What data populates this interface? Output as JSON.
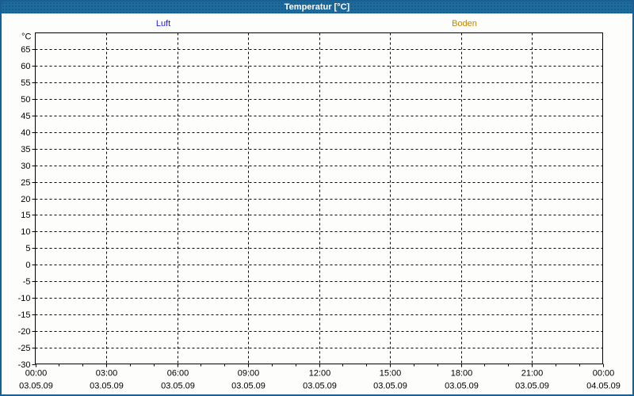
{
  "window": {
    "title": "Temperatur [°C]",
    "titlebar_color": "#1e6b9e",
    "border_color": "#1b5f90"
  },
  "chart_data": {
    "type": "line",
    "title": "Temperatur [°C]",
    "plot_empty": true,
    "grid": {
      "style": "dashed",
      "color": "#000000"
    },
    "y_axis": {
      "unit": "°C",
      "min": -30,
      "max": 70,
      "tick_step": 5,
      "ticks": [
        65,
        60,
        55,
        50,
        45,
        40,
        35,
        30,
        25,
        20,
        15,
        10,
        5,
        0,
        -5,
        -10,
        -15,
        -20,
        -25,
        -30
      ]
    },
    "x_axis": {
      "minor_divisions": 3,
      "ticks": [
        {
          "time": "00:00",
          "date": "03.05.09"
        },
        {
          "time": "03:00",
          "date": "03.05.09"
        },
        {
          "time": "06:00",
          "date": "03.05.09"
        },
        {
          "time": "09:00",
          "date": "03.05.09"
        },
        {
          "time": "12:00",
          "date": "03.05.09"
        },
        {
          "time": "15:00",
          "date": "03.05.09"
        },
        {
          "time": "18:00",
          "date": "03.05.09"
        },
        {
          "time": "21:00",
          "date": "03.05.09"
        },
        {
          "time": "00:00",
          "date": "04.05.09"
        }
      ]
    },
    "series": [
      {
        "name": "Luft",
        "color": "#2323cc",
        "values": []
      },
      {
        "name": "Boden",
        "color": "#b8860b",
        "values": []
      }
    ]
  }
}
